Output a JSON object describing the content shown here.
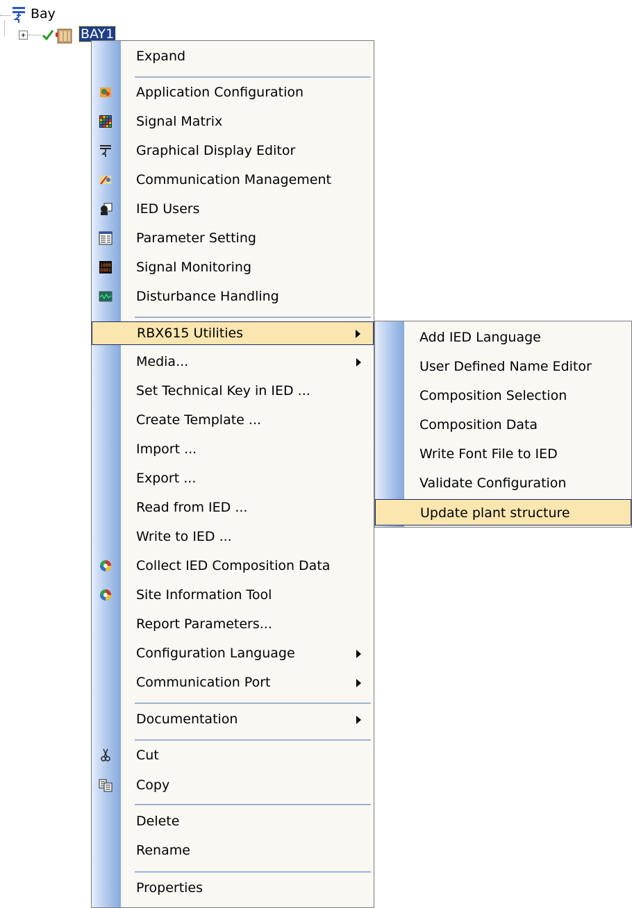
{
  "tree": {
    "root_label": "Bay",
    "child_label": "BAY1",
    "expander_symbol": "+"
  },
  "context_menu": {
    "items": [
      {
        "label": "Expand",
        "icon": "",
        "submenu": false
      },
      {
        "label": "Application Configuration",
        "icon": "application-configuration-icon",
        "submenu": false
      },
      {
        "label": "Signal Matrix",
        "icon": "signal-matrix-icon",
        "submenu": false
      },
      {
        "label": "Graphical Display Editor",
        "icon": "graphical-display-editor-icon",
        "submenu": false
      },
      {
        "label": "Communication Management",
        "icon": "communication-management-icon",
        "submenu": false
      },
      {
        "label": "IED Users",
        "icon": "ied-users-icon",
        "submenu": false
      },
      {
        "label": "Parameter Setting",
        "icon": "parameter-setting-icon",
        "submenu": false
      },
      {
        "label": "Signal Monitoring",
        "icon": "signal-monitoring-icon",
        "submenu": false
      },
      {
        "label": "Disturbance Handling",
        "icon": "disturbance-handling-icon",
        "submenu": false
      },
      {
        "label": "RBX615 Utilities",
        "icon": "",
        "submenu": true,
        "highlighted": true
      },
      {
        "label": "Media...",
        "icon": "",
        "submenu": true
      },
      {
        "label": "Set Technical Key in IED ...",
        "icon": "",
        "submenu": false
      },
      {
        "label": "Create Template ...",
        "icon": "",
        "submenu": false
      },
      {
        "label": "Import ...",
        "icon": "",
        "submenu": false
      },
      {
        "label": "Export ...",
        "icon": "",
        "submenu": false
      },
      {
        "label": "Read from IED ...",
        "icon": "",
        "submenu": false
      },
      {
        "label": "Write to IED ...",
        "icon": "",
        "submenu": false
      },
      {
        "label": "Collect IED Composition Data",
        "icon": "collect-composition-icon",
        "submenu": false
      },
      {
        "label": "Site Information Tool",
        "icon": "site-information-icon",
        "submenu": false
      },
      {
        "label": "Report Parameters...",
        "icon": "",
        "submenu": false
      },
      {
        "label": "Configuration Language",
        "icon": "",
        "submenu": true
      },
      {
        "label": "Communication Port",
        "icon": "",
        "submenu": true
      },
      {
        "label": "Documentation",
        "icon": "",
        "submenu": true
      },
      {
        "label": "Cut",
        "icon": "scissors-icon",
        "submenu": false
      },
      {
        "label": "Copy",
        "icon": "copy-icon",
        "submenu": false
      },
      {
        "label": "Delete",
        "icon": "",
        "submenu": false
      },
      {
        "label": "Rename",
        "icon": "",
        "submenu": false
      },
      {
        "label": "Properties",
        "icon": "",
        "submenu": false
      }
    ]
  },
  "submenu": {
    "items": [
      {
        "label": "Add IED Language"
      },
      {
        "label": "User Defined Name Editor"
      },
      {
        "label": "Composition Selection"
      },
      {
        "label": "Composition Data"
      },
      {
        "label": "Write Font File to IED"
      },
      {
        "label": "Validate Configuration"
      },
      {
        "label": "Update plant structure",
        "highlighted": true
      }
    ]
  },
  "colors": {
    "highlight_bg": "#fbe6b0",
    "highlight_border": "#1a2a60",
    "selection_bg": "#1f3e8a",
    "menu_bg": "#f9f8f3"
  }
}
